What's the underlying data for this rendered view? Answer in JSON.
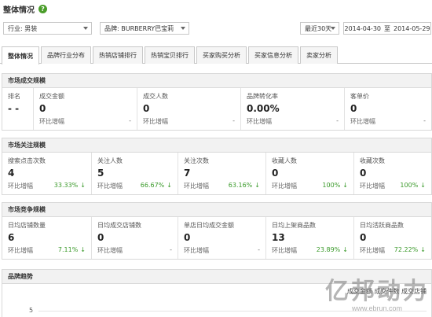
{
  "header": {
    "title": "整体情况",
    "help_icon": "help-icon"
  },
  "filters": {
    "industry": "行业: 男装",
    "brand": "品牌: BURBERRY巴宝莉",
    "period": "最近30天",
    "date_start": "2014-04-30",
    "date_sep": "至",
    "date_end": "2014-05-29"
  },
  "tabs": [
    {
      "label": "整体情况",
      "active": true
    },
    {
      "label": "品牌行业分布"
    },
    {
      "label": "热销店铺排行"
    },
    {
      "label": "热销宝贝排行"
    },
    {
      "label": "买家购买分析"
    },
    {
      "label": "买家信息分析"
    },
    {
      "label": "卖家分析"
    }
  ],
  "market_scale": {
    "title": "市场成交规模",
    "metrics": [
      {
        "label": "排名",
        "value": "- -"
      },
      {
        "label": "成交金额",
        "value": "0",
        "sub_label": "环比增幅",
        "change": "-"
      },
      {
        "label": "成交人数",
        "value": "0",
        "sub_label": "环比增幅",
        "change": "-"
      },
      {
        "label": "品牌转化率",
        "value": "0.00%",
        "sub_label": "环比增幅",
        "change": "-"
      },
      {
        "label": "客单价",
        "value": "0",
        "sub_label": "环比增幅",
        "change": "-"
      }
    ]
  },
  "market_attention": {
    "title": "市场关注规模",
    "metrics": [
      {
        "label": "搜索点击次数",
        "value": "4",
        "sub_label": "环比增幅",
        "change": "33.33%",
        "arrow": "↓"
      },
      {
        "label": "关注人数",
        "value": "5",
        "sub_label": "环比增幅",
        "change": "66.67%",
        "arrow": "↓"
      },
      {
        "label": "关注次数",
        "value": "7",
        "sub_label": "环比增幅",
        "change": "63.16%",
        "arrow": "↓"
      },
      {
        "label": "收藏人数",
        "value": "0",
        "sub_label": "环比增幅",
        "change": "100%",
        "arrow": "↓"
      },
      {
        "label": "收藏次数",
        "value": "0",
        "sub_label": "环比增幅",
        "change": "100%",
        "arrow": "↓"
      }
    ]
  },
  "market_competition": {
    "title": "市场竞争规模",
    "metrics": [
      {
        "label": "日均店铺数量",
        "value": "6",
        "sub_label": "环比增幅",
        "change": "7.11%",
        "arrow": "↓"
      },
      {
        "label": "日均成交店铺数",
        "value": "0",
        "sub_label": "环比增幅",
        "change": "-"
      },
      {
        "label": "单店日均成交金额",
        "value": "0",
        "sub_label": "环比增幅",
        "change": "-"
      },
      {
        "label": "日均上架商品数",
        "value": "13",
        "sub_label": "环比增幅",
        "change": "23.89%",
        "arrow": "↓"
      },
      {
        "label": "日均活跃商品数",
        "value": "0",
        "sub_label": "环比增幅",
        "change": "72.22%",
        "arrow": "↓"
      }
    ]
  },
  "trend": {
    "title": "品牌趋势",
    "legend": "成交金额  成交件数  成交店铺",
    "y_tick": "5"
  },
  "watermark": {
    "text": "亿邦动力",
    "url": "www.ebrun.com"
  }
}
